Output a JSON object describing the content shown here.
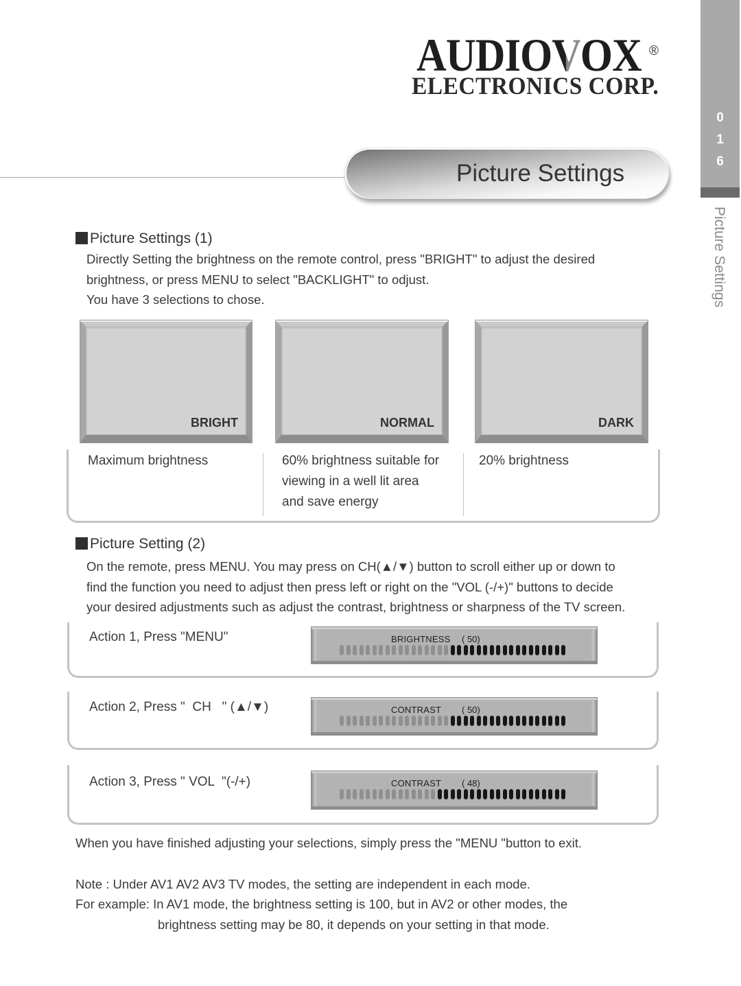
{
  "logo": {
    "wordmark_prefix": "AUDIO",
    "wordmark_v": "V",
    "wordmark_suffix": "OX",
    "registered": "®",
    "subtitle": "ELECTRONICS CORP."
  },
  "side_tab": {
    "page_digits": [
      "0",
      "1",
      "6"
    ],
    "section_label": "Picture Settings"
  },
  "title": "Picture Settings",
  "section1": {
    "heading": "Picture Settings (1)",
    "lines": [
      "Directly Setting the brightness on the remote control, press \"BRIGHT\" to adjust the desired",
      "brightness, or press MENU to select \"BACKLIGHT\" to odjust.",
      "You have 3 selections to chose."
    ],
    "modes": [
      {
        "label": "BRIGHT",
        "description_lines": [
          "Maximum brightness"
        ]
      },
      {
        "label": "NORMAL",
        "description_lines": [
          "60% brightness suitable for",
          "viewing in a well lit area",
          "and save energy"
        ]
      },
      {
        "label": "DARK",
        "description_lines": [
          "20% brightness"
        ]
      }
    ]
  },
  "section2": {
    "heading": "Picture Setting (2)",
    "lines": [
      "On the remote, press MENU.  You may press on CH(▲/▼) button to scroll either up or down to",
      "find the function you need to adjust then press left or right on the \"VOL (-/+)\" buttons to decide",
      "your desired adjustments such as adjust the contrast, brightness or sharpness of the TV screen."
    ],
    "actions": [
      {
        "label": "Action 1, Press \"MENU\"",
        "osd": {
          "item": "BRIGHTNESS",
          "value_text": "( 50)",
          "value": 50,
          "segments_light": 17,
          "segments_dark": 18
        }
      },
      {
        "label": "Action 2, Press \"  CH   \" (▲/▼)",
        "osd": {
          "item": "CONTRAST",
          "value_text": "( 50)",
          "value": 50,
          "segments_light": 17,
          "segments_dark": 18
        }
      },
      {
        "label": "Action 3, Press \" VOL  \"(-/+)",
        "osd": {
          "item": "CONTRAST",
          "value_text": "( 48)",
          "value": 48,
          "segments_light": 15,
          "segments_dark": 20
        }
      }
    ]
  },
  "footer": {
    "exit_note": "When you have finished adjusting your selections, simply press the \"MENU \"button to exit.",
    "note_lines": [
      "Note : Under AV1 AV2 AV3 TV modes, the setting are independent in each mode.",
      "For example: In AV1 mode, the brightness setting is 100, but in AV2 or other modes, the",
      "brightness setting may be 80, it depends on your setting in that mode."
    ]
  },
  "colors": {
    "side_tab": "#a9a9a9",
    "side_tab_band": "#6b6b6b",
    "segment_light": "#8f8f8f",
    "segment_dark": "#161616"
  }
}
